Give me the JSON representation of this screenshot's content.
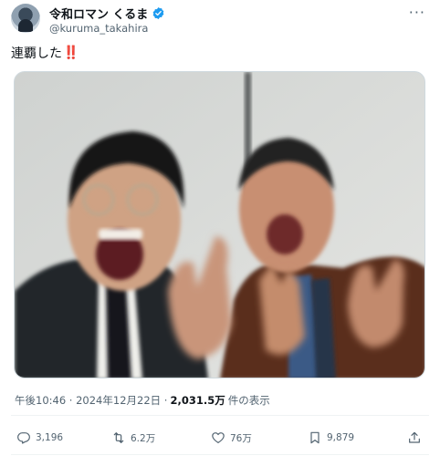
{
  "author": {
    "display_name": "令和ロマン くるま",
    "handle": "@kuruma_takahira"
  },
  "tweet": {
    "text": "連覇した",
    "emoji": "‼️"
  },
  "meta": {
    "timestamp": "午後10:46 · 2024年12月22日 · ",
    "views_count": "2,031.5万",
    "views_label": "件の表示"
  },
  "actions": {
    "reply_count": "3,196",
    "retweet_count": "6.2万",
    "like_count": "76万",
    "bookmark_count": "9,879"
  },
  "colors": {
    "verified": "#1d9bf0",
    "secondary_text": "#536471",
    "primary_text": "#0f1419"
  },
  "icons": [
    "more-icon",
    "verified-badge-icon",
    "reply-icon",
    "retweet-icon",
    "like-icon",
    "bookmark-icon",
    "share-icon"
  ]
}
